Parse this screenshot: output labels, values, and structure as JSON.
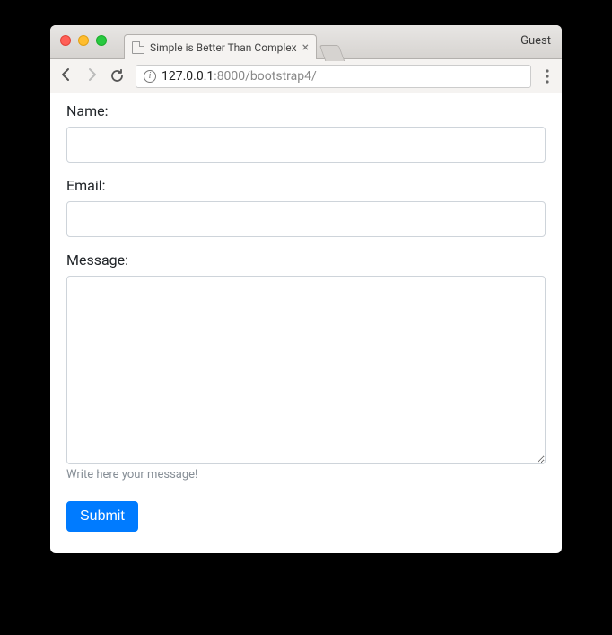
{
  "browser": {
    "tab_title": "Simple is Better Than Complex",
    "guest_label": "Guest",
    "url": {
      "host": "127.0.0.1",
      "port_path": ":8000/bootstrap4/"
    }
  },
  "form": {
    "name": {
      "label": "Name:",
      "value": ""
    },
    "email": {
      "label": "Email:",
      "value": ""
    },
    "message": {
      "label": "Message:",
      "value": "",
      "help": "Write here your message!"
    },
    "submit_label": "Submit"
  }
}
